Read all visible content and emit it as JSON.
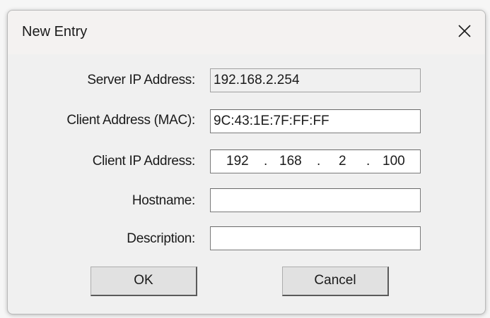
{
  "window": {
    "title": "New Entry"
  },
  "form": {
    "server_ip": {
      "label": "Server IP Address:",
      "value": "192.168.2.254"
    },
    "client_mac": {
      "label": "Client Address (MAC):",
      "value": "9C:43:1E:7F:FF:FF"
    },
    "client_ip": {
      "label": "Client IP Address:",
      "octets": [
        "192",
        "168",
        "2",
        "100"
      ],
      "separator": "."
    },
    "hostname": {
      "label": "Hostname:",
      "value": ""
    },
    "description": {
      "label": "Description:",
      "value": ""
    }
  },
  "buttons": {
    "ok": "OK",
    "cancel": "Cancel"
  },
  "icons": {
    "close": "close-icon"
  }
}
